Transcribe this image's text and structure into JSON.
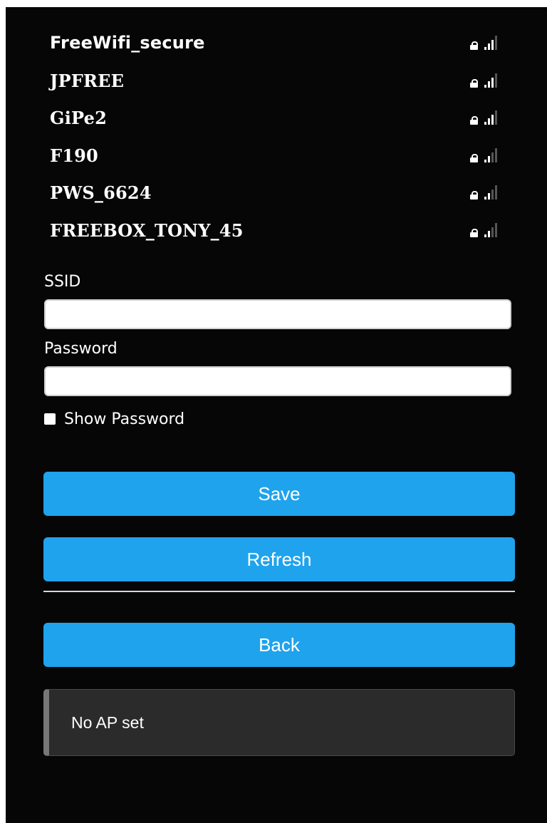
{
  "networks": [
    {
      "ssid": "FreeWifi_secure",
      "secured": true,
      "signal_bars": 3
    },
    {
      "ssid": "JPFREE",
      "secured": true,
      "signal_bars": 3
    },
    {
      "ssid": "GiPe2",
      "secured": true,
      "signal_bars": 3
    },
    {
      "ssid": "F190",
      "secured": true,
      "signal_bars": 2
    },
    {
      "ssid": "PWS_6624",
      "secured": true,
      "signal_bars": 2
    },
    {
      "ssid": "FREEBOX_TONY_45",
      "secured": true,
      "signal_bars": 2
    }
  ],
  "form": {
    "ssid_label": "SSID",
    "ssid_value": "",
    "password_label": "Password",
    "password_value": "",
    "show_password_label": "Show Password",
    "show_password_checked": false
  },
  "buttons": {
    "save_label": "Save",
    "refresh_label": "Refresh",
    "back_label": "Back"
  },
  "status": {
    "message": "No AP set"
  },
  "colors": {
    "background": "#060606",
    "button": "#1fa3ec",
    "message_box": "#2b2b2b"
  }
}
